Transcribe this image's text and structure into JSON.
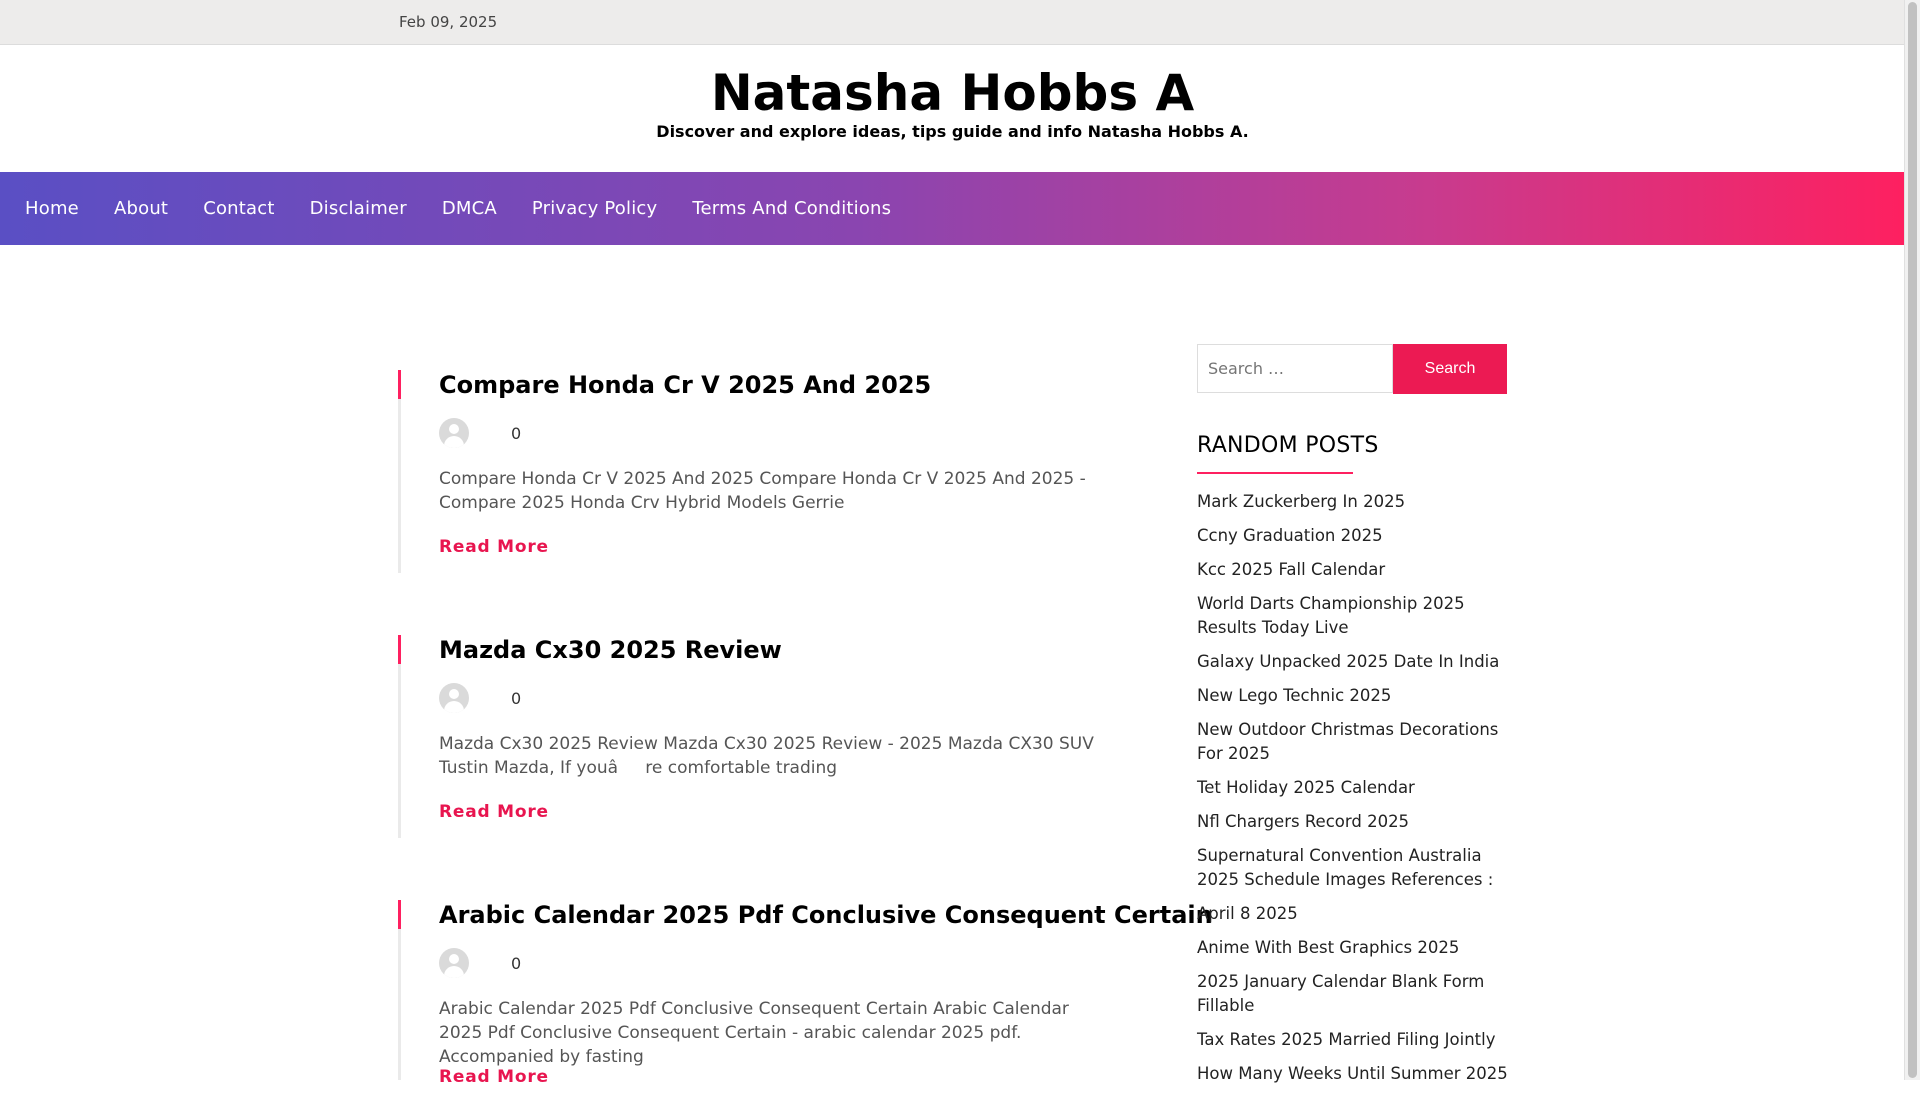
{
  "topbar": {
    "date": "Feb 09, 2025"
  },
  "site": {
    "title": "Natasha Hobbs A",
    "tagline": "Discover and explore ideas, tips guide and info Natasha Hobbs A."
  },
  "nav": [
    "Home",
    "About",
    "Contact",
    "Disclaimer",
    "DMCA",
    "Privacy Policy",
    "Terms And Conditions"
  ],
  "posts": [
    {
      "title": "Compare Honda Cr V 2025 And 2025",
      "comments": "0",
      "excerpt": "Compare Honda Cr V 2025 And 2025 Compare Honda Cr V 2025 And 2025 - Compare 2025 Honda Crv Hybrid Models Gerrie",
      "read_more": "Read More"
    },
    {
      "title": "Mazda Cx30 2025 Review",
      "comments": "0",
      "excerpt": "Mazda Cx30 2025 Review Mazda Cx30 2025 Review - 2025 Mazda CX30 SUV Tustin Mazda, If youâre comfortable trading",
      "read_more": "Read More"
    },
    {
      "title": "Arabic Calendar 2025 Pdf Conclusive Consequent Certain",
      "comments": "0",
      "excerpt": "Arabic Calendar 2025 Pdf Conclusive Consequent Certain Arabic Calendar 2025 Pdf Conclusive Consequent Certain - arabic calendar 2025 pdf. Accompanied by fasting",
      "read_more": "Read More"
    }
  ],
  "sidebar": {
    "search_placeholder": "Search …",
    "search_button": "Search",
    "random_title": "RANDOM POSTS",
    "random_posts": [
      "Mark Zuckerberg In 2025",
      "Ccny Graduation 2025",
      "Kcc 2025 Fall Calendar",
      "World Darts Championship 2025 Results Today Live",
      "Galaxy Unpacked 2025 Date In India",
      "New Lego Technic 2025",
      "New Outdoor Christmas Decorations For 2025",
      "Tet Holiday 2025 Calendar",
      "Nfl Chargers Record 2025",
      "Supernatural Convention Australia 2025 Schedule Images References :",
      "April 8 2025",
      "Anime With Best Graphics 2025",
      "2025 January Calendar Blank Form Fillable",
      "Tax Rates 2025 Married Filing Jointly",
      "How Many Weeks Until Summer 2025"
    ]
  },
  "colors": {
    "accent": "#fe2060",
    "nav_start": "#5a4fc4",
    "nav_end": "#fe2060"
  }
}
